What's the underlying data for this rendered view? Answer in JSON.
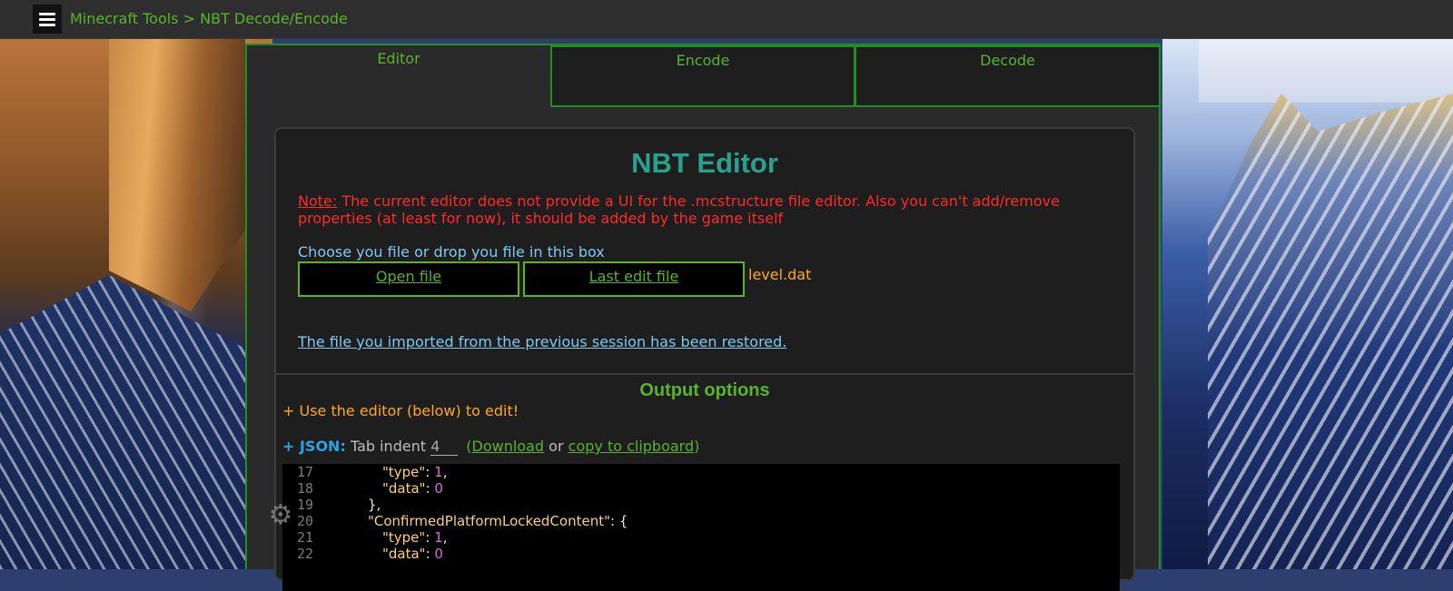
{
  "header": {
    "breadcrumb": "Minecraft Tools > NBT Decode/Encode"
  },
  "tabs": [
    {
      "label": "Editor",
      "active": true
    },
    {
      "label": "Encode",
      "active": false
    },
    {
      "label": "Decode",
      "active": false
    }
  ],
  "editor": {
    "title": "NBT Editor",
    "note_label": "Note:",
    "note_text": " The current editor does not provide a UI for the .mcstructure file editor. Also you can't add/remove properties (at least for now), it should be added by the game itself",
    "choose_text": "Choose you file or drop you file in this box",
    "open_file_label": "Open file",
    "last_edit_file_label": "Last edit file",
    "filename": "level.dat",
    "restored_text": "The file you imported from the previous session has been restored."
  },
  "output": {
    "title": "Output options",
    "use_editor_text": "+ Use the editor (below) to edit!",
    "json_label": "+ JSON:",
    "tab_indent_label": "Tab indent",
    "tab_indent_value": "4",
    "open_paren": "(",
    "download_label": "Download",
    "or_text": "or",
    "copy_label": "copy to clipboard",
    "close_paren": ")"
  },
  "code_lines": [
    {
      "num": "17",
      "key": "\"type\"",
      "val": "1",
      "suffix": ","
    },
    {
      "num": "18",
      "key": "\"data\"",
      "val": "0",
      "suffix": ""
    },
    {
      "num": "19",
      "text": "},"
    },
    {
      "num": "20",
      "key": "\"ConfirmedPlatformLockedContent\"",
      "val": "{",
      "suffix": ""
    },
    {
      "num": "21",
      "key": "\"type\"",
      "val": "1",
      "suffix": ","
    },
    {
      "num": "22",
      "key": "\"data\"",
      "val": "0",
      "suffix": ""
    }
  ],
  "colors": {
    "accent_green": "#59b32d",
    "title_teal": "#2aa18e",
    "note_red": "#ff2a2a",
    "link_blue": "#7ec9f2",
    "orange": "#ffa81a"
  },
  "icons": [
    "hamburger-menu-icon",
    "gear-icon"
  ]
}
